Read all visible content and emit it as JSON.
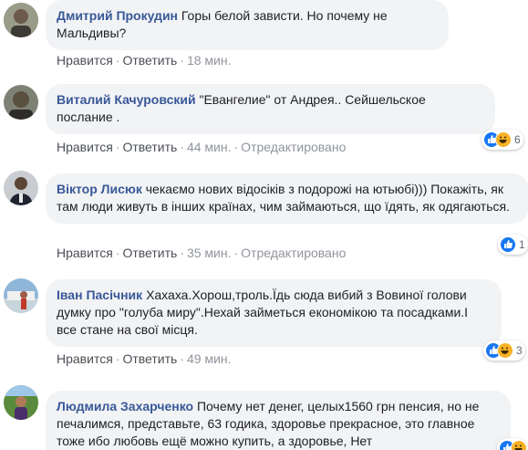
{
  "comments": [
    {
      "author": "Дмитрий Прокудин",
      "text": "Горы белой зависти. Но почему не Мальдивы?",
      "like_label": "Нравится",
      "reply_label": "Ответить",
      "time": "18 мин.",
      "edited": "",
      "reaction_count": ""
    },
    {
      "author": "Виталий Качуровский",
      "text": "\"Евангелие\" от Андрея.. Сейшельское послание .",
      "like_label": "Нравится",
      "reply_label": "Ответить",
      "time": "44 мин.",
      "edited": "Отредактировано",
      "reaction_count": "6"
    },
    {
      "author": "Віктор Лисюк",
      "text": "чекаємо нових відосіків з подорожі на ютьюбі))) Покажіть, як там люди живуть в інших країнах, чим займаються, що їдять, як одягаються.",
      "like_label": "Нравится",
      "reply_label": "Ответить",
      "time": "35 мин.",
      "edited": "Отредактировано",
      "reaction_count": "1"
    },
    {
      "author": "Іван Пасічник",
      "text": "Хахаха.Хорош,троль.Їдь сюда вибий з Вовиної голови думку про \"голуба миру\".Нехай займеться економікою та посадками.І все стане на свої місця.",
      "like_label": "Нравится",
      "reply_label": "Ответить",
      "time": "49 мин.",
      "edited": "",
      "reaction_count": "3"
    },
    {
      "author": "Людмила Захарченко",
      "text": "Почему нет денег, целых1560 грн пенсия, но не печалимся, представьте, 63 годика, здоровье прекрасное, это главное тоже ибо любовь ещё можно купить, а здоровье, Нет",
      "reaction_count": ""
    }
  ],
  "colors": {
    "author": "#385898",
    "bubble": "#f2f3f5",
    "like_blue": "#1877f2",
    "haha_yellow": "#f7b125"
  }
}
